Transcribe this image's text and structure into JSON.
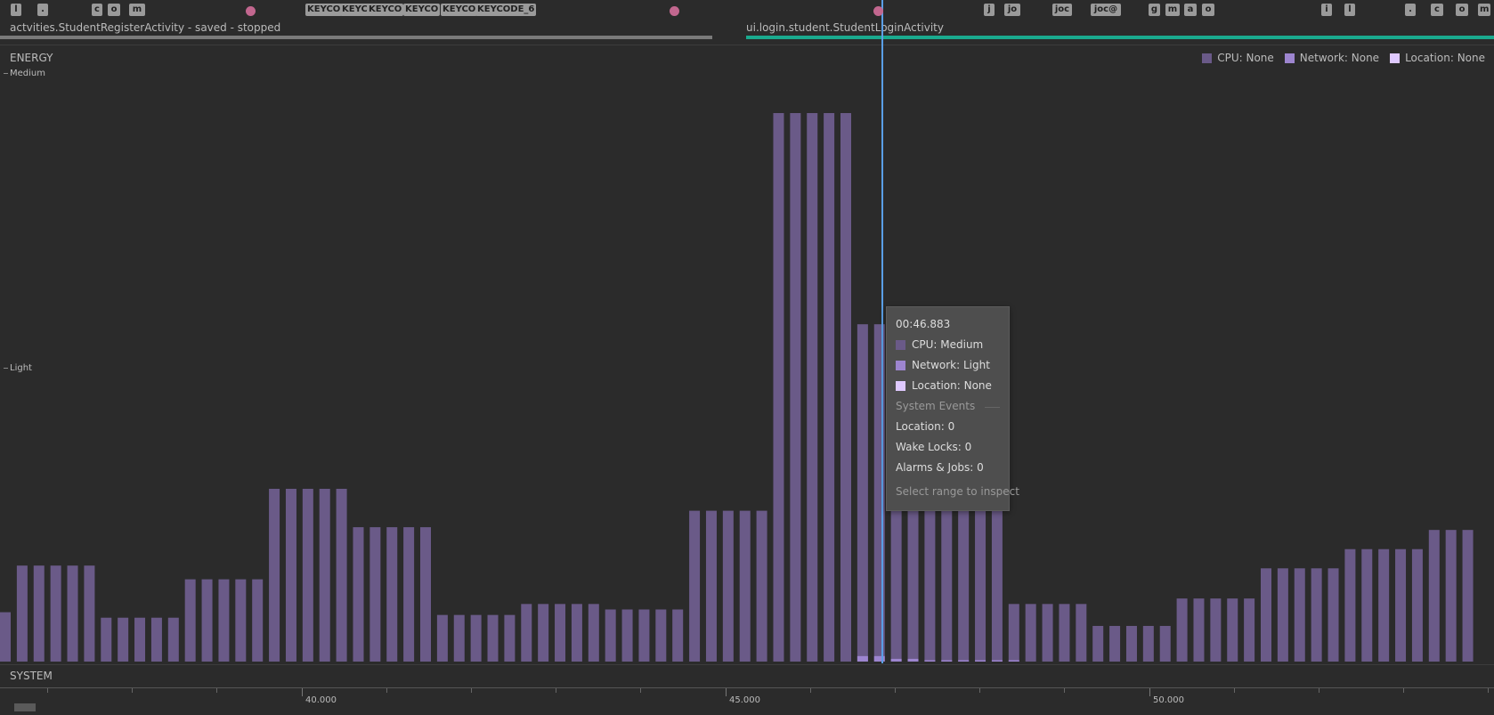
{
  "colors": {
    "background": "#2b2b2b",
    "cpu": "#6a5a88",
    "network": "#9d85cf",
    "location": "#dfc9ff",
    "cursor": "#5a9fe6",
    "touch": "#c2678f",
    "key_event": "#9a9a9a",
    "activity_stopped": "#7a7a7a",
    "activity_active": "#1aaa8e"
  },
  "events": {
    "keys": [
      "l",
      ".",
      "c",
      "o",
      "m",
      "KEYCO",
      "KEYC",
      "KEYCO",
      "KEYCO",
      "KEYCO",
      "KEYCODE_6",
      "j",
      "jo",
      "joc",
      "joc@",
      "g",
      "m",
      "a",
      "o",
      "i",
      "l",
      ".",
      "c",
      "o",
      "m"
    ],
    "touch_count": 3
  },
  "activities": [
    {
      "label": "actvities.StudentRegisterActivity - saved - stopped",
      "state": "stopped"
    },
    {
      "label": "ui.login.student.StudentLoginActivity",
      "state": "active"
    }
  ],
  "energy": {
    "title": "ENERGY",
    "y_levels": [
      "Medium",
      "Light"
    ],
    "legend": [
      {
        "label": "CPU: None",
        "color_key": "cpu"
      },
      {
        "label": "Network: None",
        "color_key": "network"
      },
      {
        "label": "Location: None",
        "color_key": "location"
      }
    ]
  },
  "tooltip": {
    "time": "00:46.883",
    "rows": [
      {
        "label": "CPU: Medium",
        "color_key": "cpu"
      },
      {
        "label": "Network: Light",
        "color_key": "network"
      },
      {
        "label": "Location: None",
        "color_key": "location"
      }
    ],
    "section_title": "System Events",
    "events": [
      "Location: 0",
      "Wake Locks: 0",
      "Alarms & Jobs: 0"
    ],
    "hint": "Select range to inspect"
  },
  "system": {
    "title": "SYSTEM",
    "ticks": [
      "40.000",
      "45.000",
      "50.000"
    ]
  },
  "chart_data": {
    "type": "bar",
    "title": "ENERGY",
    "ylabel": "",
    "y_levels": [
      "None",
      "Light",
      "Medium"
    ],
    "ylim": [
      0,
      2
    ],
    "x_unit": "seconds",
    "x_range": [
      36.4,
      53.9
    ],
    "x_ticks": [
      40.0,
      45.0,
      50.0
    ],
    "series": [
      {
        "name": "CPU",
        "x": [
          36.4,
          36.6,
          36.8,
          37.0,
          37.2,
          37.4,
          37.6,
          37.8,
          38.0,
          38.2,
          38.4,
          38.6,
          38.8,
          39.0,
          39.2,
          39.4,
          39.6,
          39.8,
          40.0,
          40.2,
          40.4,
          40.6,
          40.8,
          41.0,
          41.2,
          41.4,
          41.6,
          41.8,
          42.0,
          42.2,
          42.4,
          42.6,
          42.8,
          43.0,
          43.2,
          43.4,
          43.6,
          43.8,
          44.0,
          44.2,
          44.4,
          44.6,
          44.8,
          45.0,
          45.2,
          45.4,
          45.6,
          45.8,
          46.0,
          46.2,
          46.4,
          46.6,
          46.8,
          47.0,
          47.2,
          47.4,
          47.6,
          47.8,
          48.0,
          48.2,
          48.4,
          48.6,
          48.8,
          49.0,
          49.2,
          49.4,
          49.6,
          49.8,
          50.0,
          50.2,
          50.4,
          50.6,
          50.8,
          51.0,
          51.2,
          51.4,
          51.6,
          51.8,
          52.0,
          52.2,
          52.4,
          52.6,
          52.8,
          53.0,
          53.2,
          53.4,
          53.6,
          53.8
        ],
        "values": [
          0.18,
          0.35,
          0.35,
          0.35,
          0.35,
          0.35,
          0.16,
          0.16,
          0.16,
          0.16,
          0.16,
          0.3,
          0.3,
          0.3,
          0.3,
          0.3,
          0.63,
          0.63,
          0.63,
          0.63,
          0.63,
          0.49,
          0.49,
          0.49,
          0.49,
          0.49,
          0.17,
          0.17,
          0.17,
          0.17,
          0.17,
          0.21,
          0.21,
          0.21,
          0.21,
          0.21,
          0.19,
          0.19,
          0.19,
          0.19,
          0.19,
          0.55,
          0.55,
          0.55,
          0.55,
          0.55,
          2.0,
          2.0,
          2.0,
          2.0,
          2.0,
          1.23,
          1.23,
          1.23,
          0.55,
          0.55,
          0.55,
          0.55,
          0.55,
          0.55,
          0.21,
          0.21,
          0.21,
          0.21,
          0.21,
          0.13,
          0.13,
          0.13,
          0.13,
          0.13,
          0.23,
          0.23,
          0.23,
          0.23,
          0.23,
          0.34,
          0.34,
          0.34,
          0.34,
          0.34,
          0.41,
          0.41,
          0.41,
          0.41,
          0.41,
          0.48,
          0.48,
          0.48
        ]
      },
      {
        "name": "Network",
        "x": [
          46.6,
          46.8,
          47.0,
          47.2,
          47.4,
          47.6,
          47.8,
          48.0,
          48.2,
          48.4
        ],
        "values": [
          0.02,
          0.02,
          0.01,
          0.01,
          0.005,
          0.005,
          0.005,
          0.005,
          0.005,
          0.005
        ]
      }
    ]
  }
}
